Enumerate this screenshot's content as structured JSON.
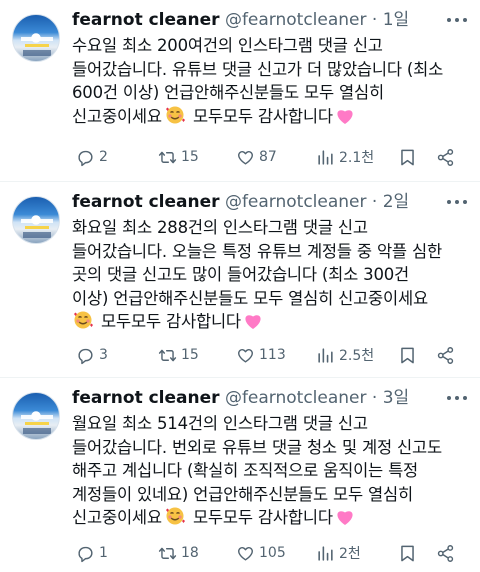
{
  "tweets": [
    {
      "name": "fearnot cleaner",
      "handle": "@fearnotcleaner",
      "time": "· 1일",
      "lines": [
        "수요일 최소 200여건의 인스타그램 댓글 신고",
        "들어갔습니다. 유튜브 댓글 신고가 더 많았습니다 (최소",
        "600건 이상) 언급안해주신분들도 모두 열심히",
        "신고중이세요",
        "모두모두 감사합니다"
      ],
      "replies": "2",
      "retweets": "15",
      "likes": "87",
      "views": "2.1천"
    },
    {
      "name": "fearnot cleaner",
      "handle": "@fearnotcleaner",
      "time": "· 2일",
      "lines": [
        "화요일 최소 288건의 인스타그램 댓글 신고",
        "들어갔습니다. 오늘은 특정 유튜브 계정들 중 악플 심한",
        "곳의 댓글 신고도 많이 들어갔습니다 (최소 300건",
        "이상) 언급안해주신분들도 모두 열심히 신고중이세요",
        "",
        "모두모두 감사합니다"
      ],
      "replies": "3",
      "retweets": "15",
      "likes": "113",
      "views": "2.5천"
    },
    {
      "name": "fearnot cleaner",
      "handle": "@fearnotcleaner",
      "time": "· 3일",
      "lines": [
        "월요일 최소 514건의 인스타그램 댓글 신고",
        "들어갔습니다. 번외로 유튜브 댓글 청소 및 계정 신고도",
        "해주고 계십니다 (확실히 조직적으로 움직이는 특정",
        "계정들이 있네요) 언급안해주신분들도 모두 열심히",
        "신고중이세요",
        "모두모두 감사합니다"
      ],
      "replies": "1",
      "retweets": "18",
      "likes": "105",
      "views": "2천"
    }
  ],
  "icons": {
    "reply": "reply-icon",
    "retweet": "retweet-icon",
    "like": "heart-icon",
    "views": "views-icon",
    "bookmark": "bookmark-icon",
    "share": "share-icon",
    "more": "more-icon"
  },
  "colors": {
    "text": "#0f1419",
    "secondary": "#536471",
    "divider": "#eff3f4",
    "heart_emoji": "#ff7ac6"
  }
}
